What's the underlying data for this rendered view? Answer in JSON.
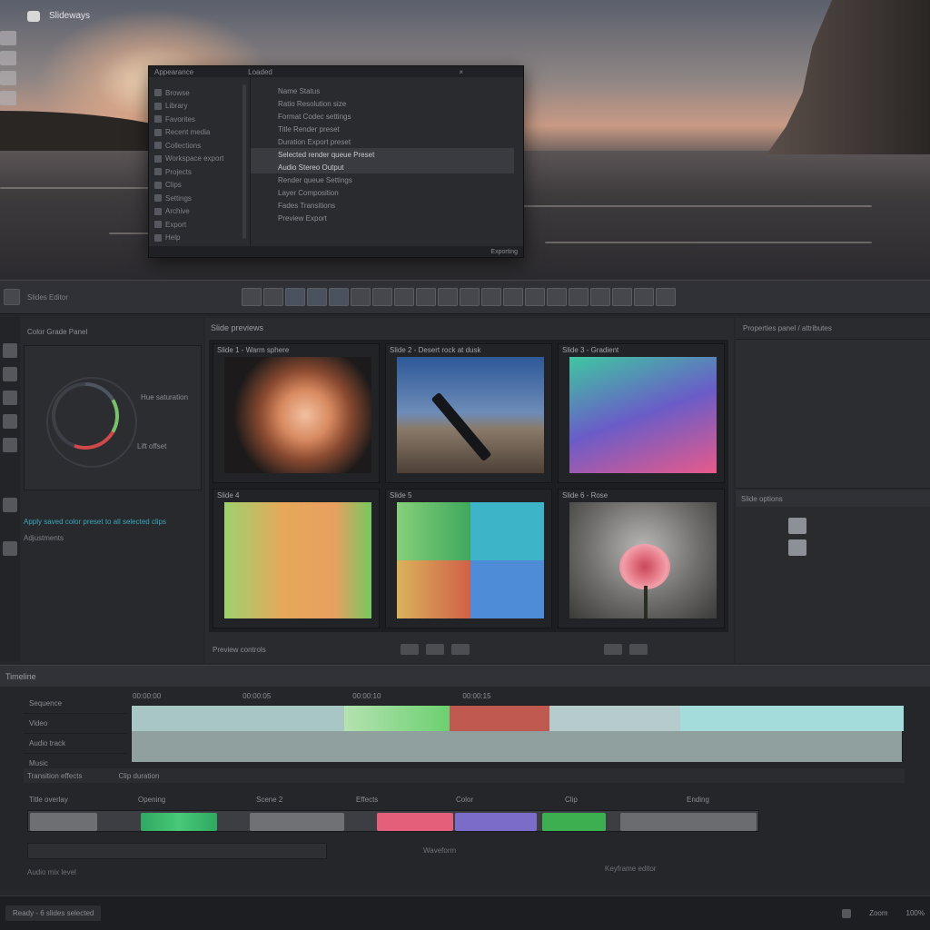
{
  "desktop": {
    "app_name": "Slideways"
  },
  "float_window": {
    "title": "Appearance",
    "subtitle": "Loaded",
    "side_items": [
      "Browse",
      "Library",
      "Favorites",
      "Recent media",
      "Collections",
      "Workspace export",
      "Projects",
      "Clips",
      "Settings",
      "Archive",
      "Export",
      "Help"
    ],
    "rows": [
      "Name   Status",
      "Ratio   Resolution size",
      "Format   Codec settings",
      "Title   Render preset",
      "Duration   Export preset",
      "Selected render queue   Preset   ",
      "Audio   Stereo   Output",
      "Render queue   Settings",
      "Layer   Composition",
      "Fades   Transitions",
      "Preview   Export"
    ],
    "status": "Exporting"
  },
  "toolbar": {
    "title": "Slides Editor",
    "tools": [
      "cut",
      "select",
      "crop",
      "text",
      "shape",
      "pen",
      "trim",
      "grid",
      "slip",
      "slide",
      "zoom",
      "hand",
      "audio",
      "mask",
      "fx",
      "color",
      "link",
      "marker",
      "view",
      "export"
    ]
  },
  "left_panel": {
    "header": "Color Grade Panel",
    "wheel_label_top": "Hue saturation",
    "wheel_label_bottom": "Lift offset",
    "link_text": "Apply saved color preset to all selected clips",
    "sub_text": "Adjustments"
  },
  "viewer": {
    "title": "Slide previews",
    "thumbs": [
      {
        "label": "Slide 1 - Warm sphere"
      },
      {
        "label": "Slide 2 - Desert rock at dusk"
      },
      {
        "label": "Slide 3 - Gradient"
      },
      {
        "label": "Slide 4"
      },
      {
        "label": "Slide 5"
      },
      {
        "label": "Slide 6 - Rose"
      }
    ],
    "bottom_label": "Preview controls"
  },
  "right_panel": {
    "header": "Properties panel / attributes",
    "section2": "Slide options"
  },
  "timeline": {
    "header": "Timeline",
    "track_labels": [
      "Sequence",
      "Video",
      "Audio track",
      "Music"
    ],
    "ruler": [
      "00:00:00",
      "00:00:05",
      "00:00:10",
      "00:00:15"
    ],
    "row2": [
      "Transition effects",
      "Clip duration"
    ],
    "row3": [
      "Title overlay",
      "Opening",
      "Scene 2",
      "Effects",
      "Color",
      "Clip",
      "Ending"
    ],
    "bottom_left": "Audio mix level",
    "bottom_mid": "Waveform",
    "bottom_right": "Keyframe editor"
  },
  "statusbar": {
    "left": "Ready - 6 slides selected",
    "right1": "Zoom",
    "right2": "100%"
  }
}
